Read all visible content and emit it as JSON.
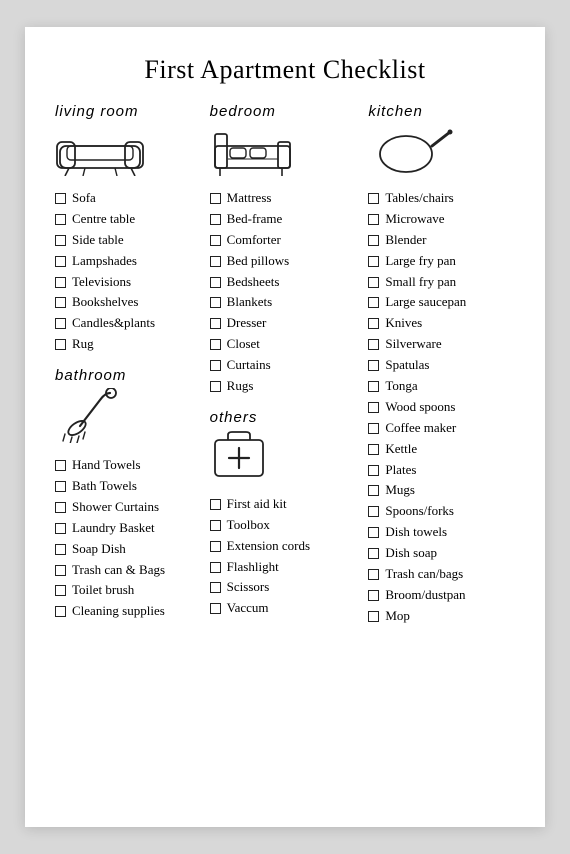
{
  "title": "First Apartment Checklist",
  "sections": {
    "living_room": {
      "label": "living room",
      "items": [
        "Sofa",
        "Centre table",
        "Side table",
        "Lampshades",
        "Televisions",
        "Bookshelves",
        "Candles&plants",
        "Rug"
      ]
    },
    "bathroom": {
      "label": "bathroom",
      "items": [
        "Hand Towels",
        "Bath Towels",
        "Shower Curtains",
        "Laundry Basket",
        "Soap Dish",
        "Trash can & Bags",
        "Toilet brush",
        "Cleaning supplies"
      ]
    },
    "bedroom": {
      "label": "bedroom",
      "items": [
        "Mattress",
        "Bed-frame",
        "Comforter",
        "Bed pillows",
        "Bedsheets",
        "Blankets",
        "Dresser",
        "Closet",
        "Curtains",
        "Rugs"
      ]
    },
    "others": {
      "label": "others",
      "items": [
        "First aid kit",
        "Toolbox",
        "Extension cords",
        "Flashlight",
        "Scissors",
        "Vaccum"
      ]
    },
    "kitchen": {
      "label": "kitchen",
      "items": [
        "Tables/chairs",
        "Microwave",
        "Blender",
        "Large fry pan",
        "Small fry pan",
        "Large saucepan",
        "Knives",
        "Silverware",
        "Spatulas",
        "Tonga",
        "Wood spoons",
        "Coffee maker",
        "Kettle",
        "Plates",
        "Mugs",
        "Spoons/forks",
        "Dish towels",
        "Dish soap",
        "Trash can/bags",
        "Broom/dustpan",
        "Mop"
      ]
    }
  }
}
